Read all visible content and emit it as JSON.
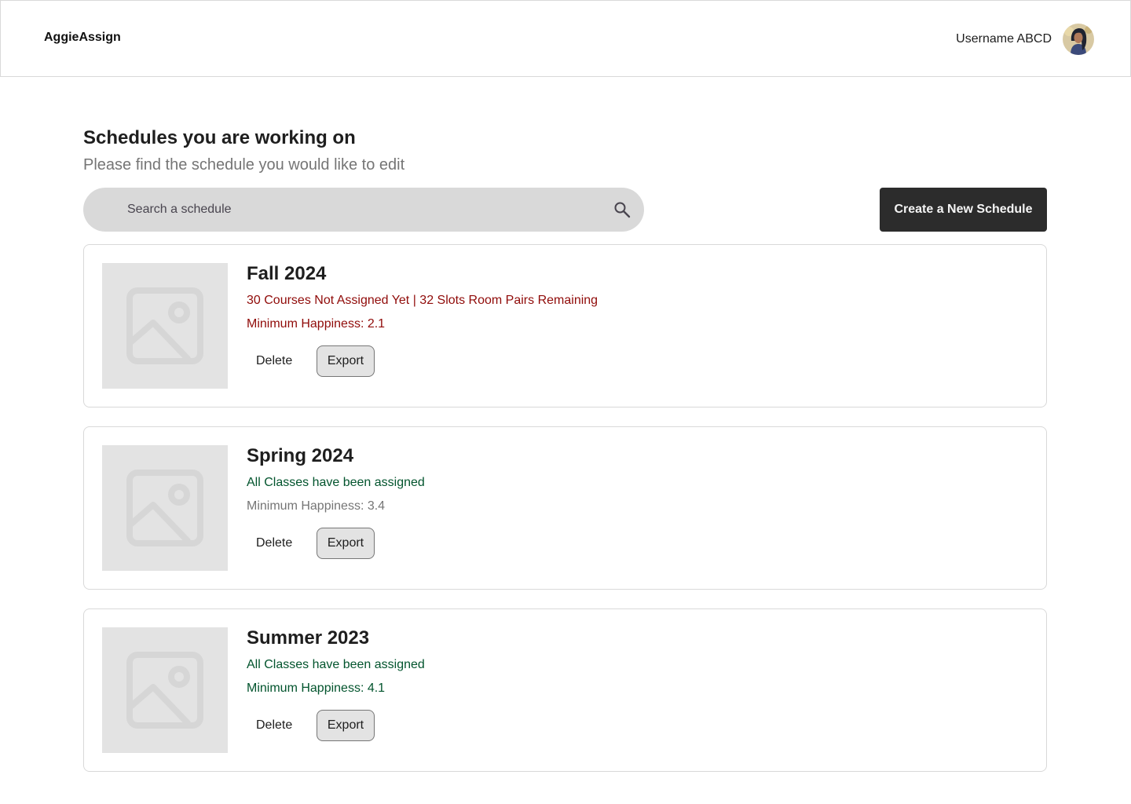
{
  "header": {
    "brand": "AggieAssign",
    "username": "Username ABCD",
    "avatar_icon": "user-avatar"
  },
  "main": {
    "title": "Schedules you are working on",
    "subtitle": "Please find the schedule you would like to edit",
    "search": {
      "placeholder": "Search a schedule",
      "value": "",
      "icon": "search-icon"
    },
    "create_button": "Create a New Schedule"
  },
  "schedules": [
    {
      "name": "Fall 2024",
      "status": "30 Courses Not Assigned Yet | 32 Slots Room Pairs Remaining",
      "status_color": "#900B09",
      "happiness": "Minimum Happiness: 2.1",
      "happiness_color": "#900B09",
      "delete_label": "Delete",
      "export_label": "Export"
    },
    {
      "name": "Spring 2024",
      "status": "All Classes have been assigned",
      "status_color": "#02542D",
      "happiness": "Minimum Happiness: 3.4",
      "happiness_color": "#757575",
      "delete_label": "Delete",
      "export_label": "Export"
    },
    {
      "name": "Summer 2023",
      "status": "All Classes have been assigned",
      "status_color": "#02542D",
      "happiness": "Minimum Happiness: 4.1",
      "happiness_color": "#02542D",
      "delete_label": "Delete",
      "export_label": "Export"
    }
  ]
}
